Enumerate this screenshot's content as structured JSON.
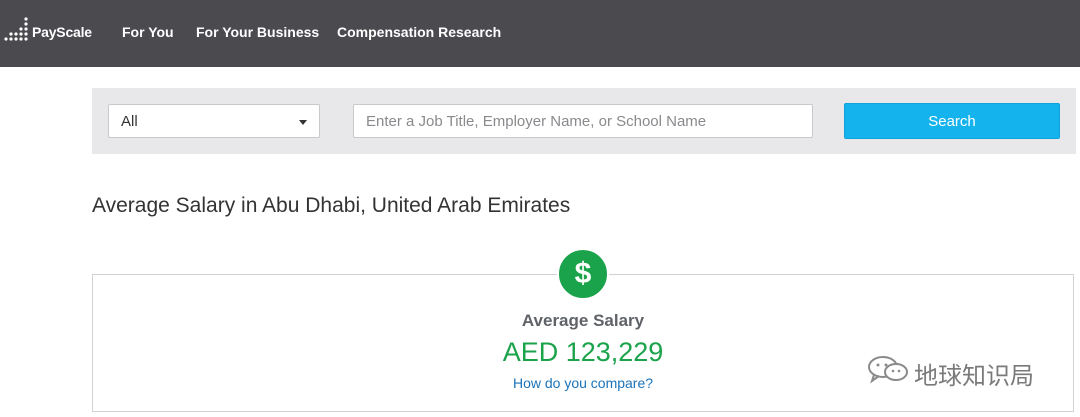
{
  "header": {
    "logo_text": "PayScale",
    "nav": [
      "For You",
      "For Your Business",
      "Compensation Research"
    ]
  },
  "search": {
    "category_selected": "All",
    "placeholder": "Enter a Job Title, Employer Name, or School Name",
    "value": "",
    "button_label": "Search"
  },
  "page": {
    "title": "Average Salary in Abu Dhabi, United Arab Emirates"
  },
  "salary_card": {
    "icon": "dollar-icon",
    "icon_glyph": "$",
    "label": "Average Salary",
    "value": "AED 123,229",
    "compare_link": "How do you compare?"
  },
  "watermark": {
    "text": "地球知识局"
  },
  "colors": {
    "topbar": "#4a4a4f",
    "search_band": "#e8e8ea",
    "search_button": "#15b3ee",
    "salary_green": "#1aa34a",
    "link_blue": "#1a73b8"
  }
}
